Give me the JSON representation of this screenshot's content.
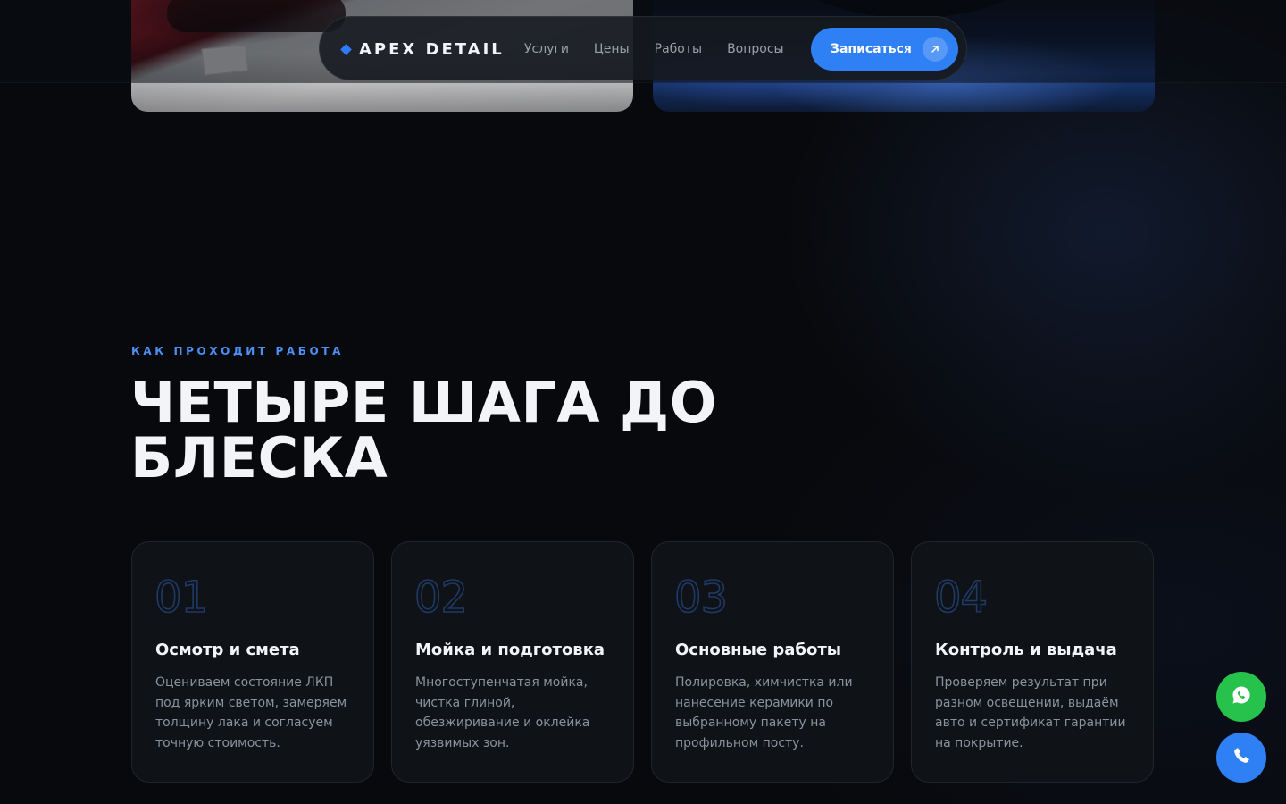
{
  "brand": {
    "name": "APEX DETAIL",
    "accent": "#2f80f5"
  },
  "nav": {
    "links": [
      "Услуги",
      "Цены",
      "Работы",
      "Вопросы"
    ],
    "cta_label": "Записаться",
    "cta_icon": "arrow-up-right-icon"
  },
  "section": {
    "eyebrow": "КАК ПРОХОДИТ РАБОТА",
    "heading_line1": "ЧЕТЫРЕ ШАГА ДО",
    "heading_line2": "БЛЕСКА"
  },
  "steps": [
    {
      "number": "01",
      "title": "Осмотр и смета",
      "text": "Оцениваем состояние ЛКП под ярким светом, замеряем толщину лака и согласуем точную стоимость."
    },
    {
      "number": "02",
      "title": "Мойка и подготовка",
      "text": "Многоступенчатая мойка, чистка глиной, обезжиривание и оклейка уязвимых зон."
    },
    {
      "number": "03",
      "title": "Основные работы",
      "text": "Полировка, химчистка или нанесение керамики по выбранному пакету на профильном посту."
    },
    {
      "number": "04",
      "title": "Контроль и выдача",
      "text": "Проверяем результат при разном освещении, выдаём авто и сертификат гарантии на покрытие."
    }
  ],
  "floating": {
    "whatsapp_icon": "whatsapp-icon",
    "whatsapp_color": "#27c24c",
    "call_icon": "phone-icon",
    "call_color": "#2f80f5"
  }
}
